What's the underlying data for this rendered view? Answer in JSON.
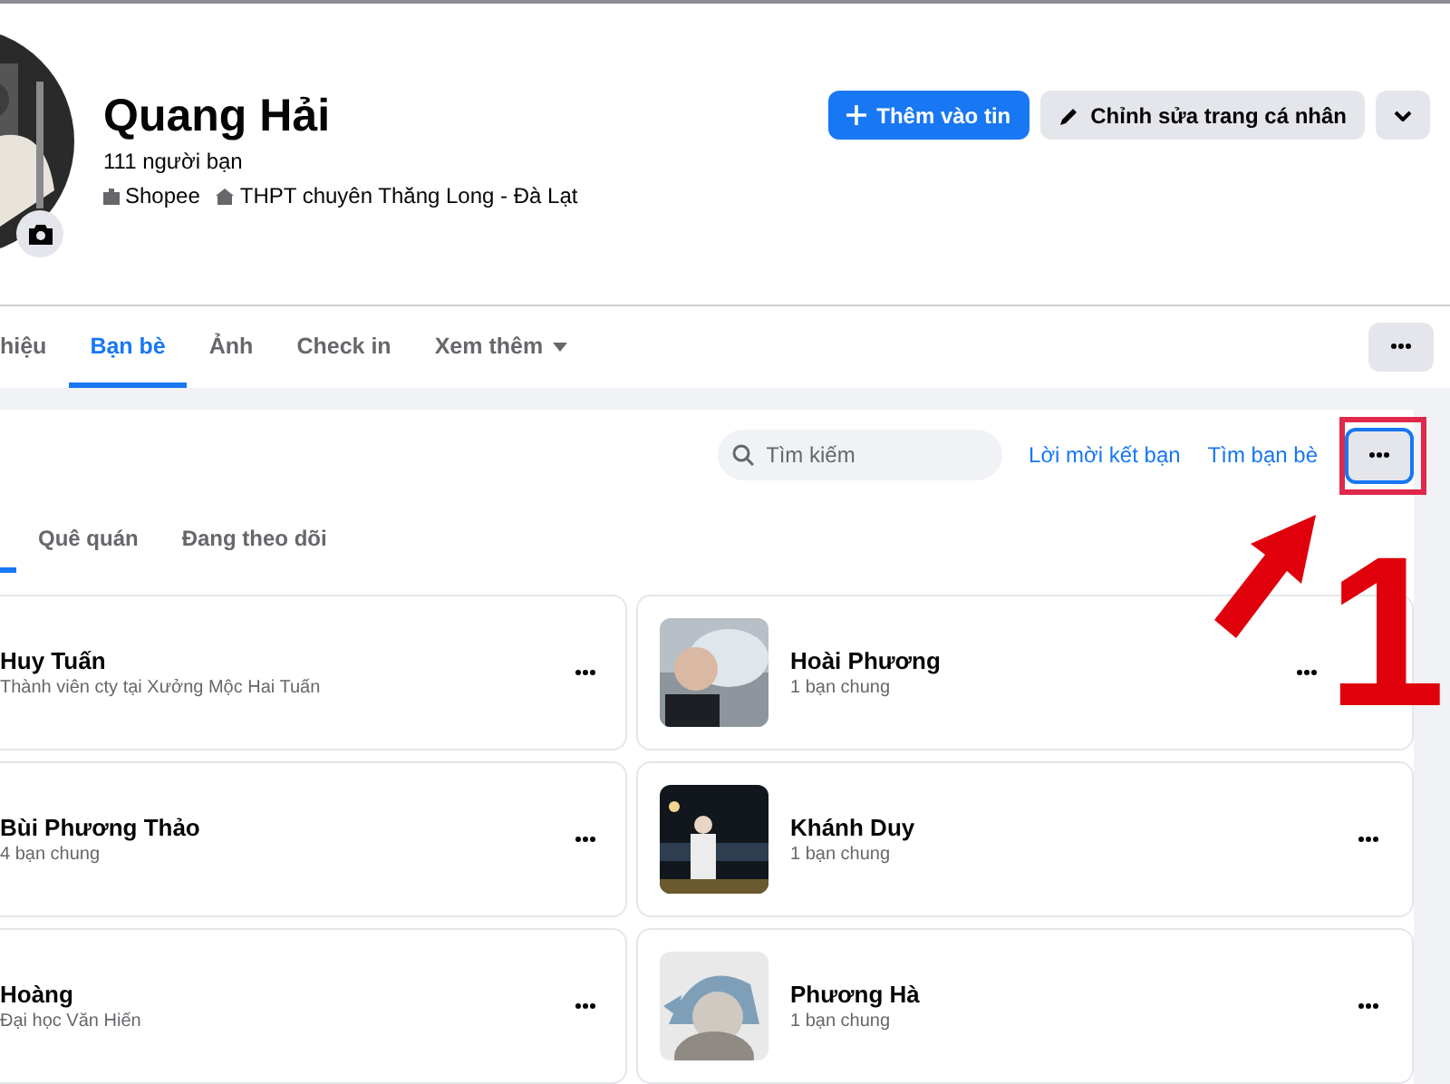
{
  "profile": {
    "name": "Quang Hải",
    "friend_count": "111 người bạn",
    "details": [
      {
        "kind": "work",
        "text": "Shopee"
      },
      {
        "kind": "school",
        "text": "THPT chuyên Thăng Long - Đà Lạt"
      }
    ],
    "buttons": [
      {
        "kind": "add",
        "label": "Thêm vào tin"
      },
      {
        "kind": "edit",
        "label": "Chỉnh sửa trang cá nhân"
      },
      {
        "kind": "menu"
      }
    ]
  },
  "tabs": [
    {
      "label": "hiệu",
      "selected": false,
      "dropdown": false
    },
    {
      "label": "Bạn bè",
      "selected": true,
      "dropdown": false
    },
    {
      "label": "Ảnh",
      "selected": false,
      "dropdown": false
    },
    {
      "label": "Check in",
      "selected": false,
      "dropdown": false
    },
    {
      "label": "Xem thêm",
      "selected": false,
      "dropdown": true
    }
  ],
  "friends_toolbar": {
    "search": {
      "placeholder": "Tìm kiếm"
    },
    "links": [
      "Lời mời kết bạn",
      "Tìm bạn bè"
    ],
    "more_highlighted": true
  },
  "subtabs": [
    {
      "label": "Quê quán",
      "selected": false
    },
    {
      "label": "Đang theo dõi",
      "selected": false
    }
  ],
  "friends": [
    {
      "name": "Huy Tuấn",
      "info": "Thành viên cty tại Xưởng Mộc Hai Tuấn"
    },
    {
      "name": "Hoài Phương",
      "info": "1 bạn chung"
    },
    {
      "name": "Bùi Phương Thảo",
      "info": "4 bạn chung"
    },
    {
      "name": "Khánh Duy",
      "info": "1 bạn chung"
    },
    {
      "name": "Hoàng",
      "info": "Đại học Văn Hiến"
    },
    {
      "name": "Phương Hà",
      "info": "1 bạn chung"
    }
  ],
  "annotation": {
    "step": "1"
  }
}
